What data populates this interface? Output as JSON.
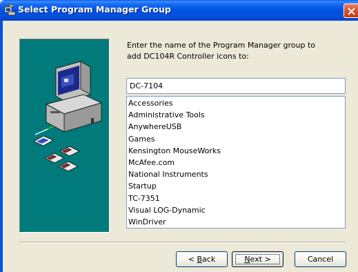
{
  "window": {
    "title": "Select Program Manager Group",
    "icon": "setup-icon",
    "close_icon": "close-icon"
  },
  "prompt": {
    "line1": "Enter the name of the Program Manager group to",
    "line2": "add DC104R Controller icons to:"
  },
  "group_input": {
    "value": "DC-7104"
  },
  "groups": [
    "Accessories",
    "Administrative Tools",
    "AnywhereUSB",
    "Games",
    "Kensington MouseWorks",
    "McAfee.com",
    "National Instruments",
    "Startup",
    "TC-7351",
    "Visual LOG-Dynamic",
    "WinDriver"
  ],
  "buttons": {
    "back_prefix": "< ",
    "back_key": "B",
    "back_rest": "ack",
    "next_key": "N",
    "next_rest": "ext >",
    "cancel": "Cancel"
  },
  "colors": {
    "titlebar": "#0054e3",
    "panel": "#007a7a",
    "dialog_bg": "#ece9d8",
    "close": "#d8512f"
  }
}
